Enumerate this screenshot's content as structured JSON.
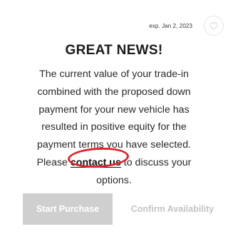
{
  "offer": {
    "expiry": "exp. Jan 2, 2023",
    "favorite_icon": "heart-outline-icon"
  },
  "content": {
    "title": "GREAT NEWS!",
    "message_lead": "The current value of your trade-in combined with the proposed down payment for your new vehicle has resulted in positive equity for the payment terms you have selected. Please ",
    "link_text": "contact us",
    "message_tail": " to discuss your options."
  },
  "actions": {
    "start_purchase": "Start Purchase",
    "confirm_availability": "Confirm Availability"
  },
  "colors": {
    "highlight": "#e0242c",
    "disabled_button": "#cfcfcf",
    "disabled_text": "#c4c4c4"
  }
}
